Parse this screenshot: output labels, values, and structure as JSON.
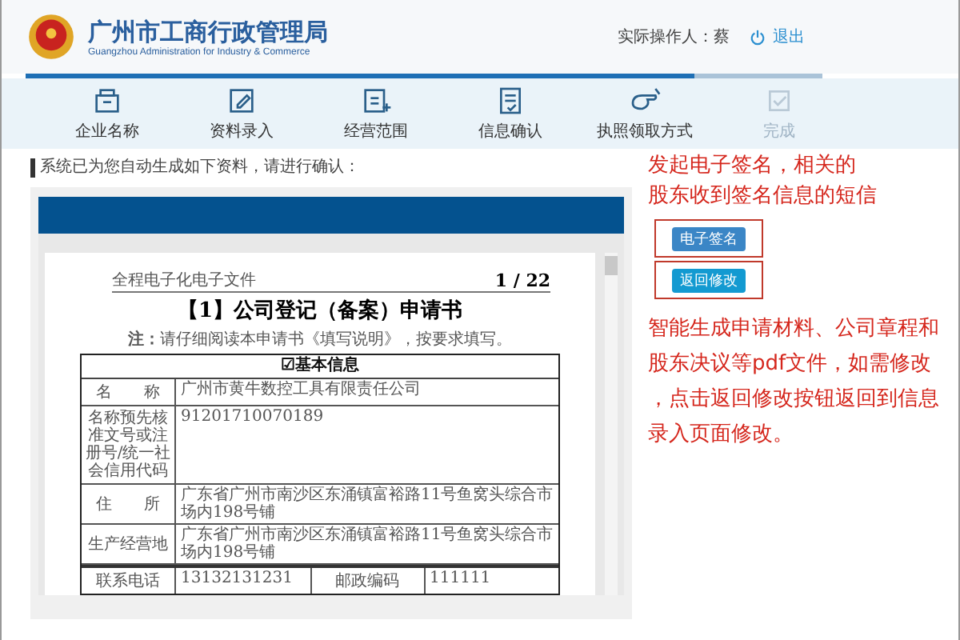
{
  "header": {
    "title": "广州市工商行政管理局",
    "subtitle": "Guangzhou Administration for Industry & Commerce",
    "operator": "实际操作人：蔡",
    "logout": "退出"
  },
  "progress": {
    "level": 0.84
  },
  "steps": [
    {
      "label": "企业名称",
      "disabled": false
    },
    {
      "label": "资料录入",
      "disabled": false
    },
    {
      "label": "经营范围",
      "disabled": false
    },
    {
      "label": "信息确认",
      "disabled": false
    },
    {
      "label": "执照领取方式",
      "disabled": false
    },
    {
      "label": "完成",
      "disabled": true
    }
  ],
  "instruction": "系统已为您自动生成如下资料，请进行确认：",
  "document": {
    "header_text": "全程电子化电子文件",
    "page": "1 / 22",
    "title": "【1】公司登记（备案）申请书",
    "note": "**注：**请仔细阅读本申请书《填写说明》，按要求填写。",
    "section": "☑基本信息",
    "rows": [
      {
        "label": "名　　称",
        "value": "广州市黄牛数控工具有限责任公司"
      },
      {
        "label": "名称预先核准文号或注册号/统一社会信用代码",
        "value": "91201710070189"
      },
      {
        "label": "住　　所",
        "value": "广东省广州市南沙区东涌镇富裕路11号鱼窝头综合市场内198号铺"
      },
      {
        "label": "生产经营地",
        "value": "广东省广州市南沙区东涌镇富裕路11号鱼窝头综合市场内198号铺"
      }
    ],
    "contact": {
      "label": "联系电话",
      "value": "13132131231",
      "postcode_label": "邮政编码",
      "postcode": "111111"
    }
  },
  "buttons": [
    {
      "label": "电子签名",
      "kind": "sign"
    },
    {
      "label": "返回修改",
      "kind": "back"
    }
  ],
  "annotations": [
    {
      "lines": [
        "发起电子签名，相关的",
        "股东收到签名信息的短信"
      ]
    },
    {
      "lines": [
        "智能生成申请材料、公司章程和",
        "股东决议等pdf文件，如需修改",
        "，点击返回修改按钮返回到信息",
        "录入页面修改。"
      ]
    }
  ]
}
